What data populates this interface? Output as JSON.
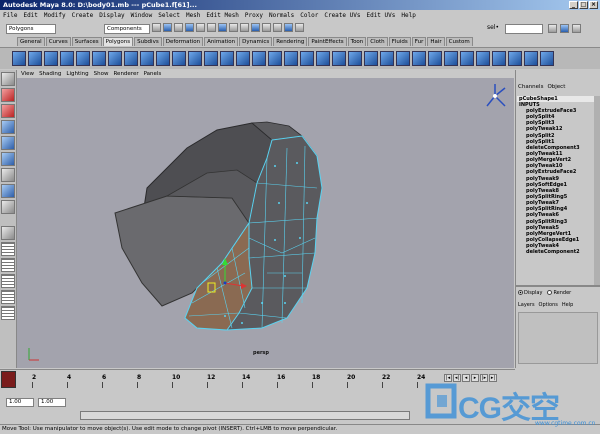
{
  "window": {
    "title": "Autodesk Maya 8.0: D:\\body01.mb   ---   pCube1.f[61]..."
  },
  "menubar": {
    "items": [
      "File",
      "Edit",
      "Modify",
      "Create",
      "Display",
      "Window",
      "Select",
      "Mesh",
      "Edit Mesh",
      "Proxy",
      "Normals",
      "Color",
      "Create UVs",
      "Edit UVs",
      "Help"
    ]
  },
  "statusline": {
    "menu_set": "Polygons",
    "select_mode": "Components",
    "sel_label": "sel•"
  },
  "shelf": {
    "tabs": [
      "General",
      "Curves",
      "Surfaces",
      "Polygons",
      "Subdivs",
      "Deformation",
      "Animation",
      "Dynamics",
      "Rendering",
      "PaintEffects",
      "Toon",
      "Cloth",
      "Fluids",
      "Fur",
      "Hair",
      "Custom"
    ],
    "active_tab": "Polygons"
  },
  "panel": {
    "menus": [
      "View",
      "Shading",
      "Lighting",
      "Show",
      "Renderer",
      "Panels"
    ],
    "camera": "persp"
  },
  "channelbox": {
    "menus": [
      "Channels",
      "Object"
    ],
    "shape": "pCubeShape1",
    "inputs_label": "INPUTS",
    "inputs": [
      "polyExtrudeFace3",
      "polySplit4",
      "polySplit3",
      "polyTweak12",
      "polySplit2",
      "polySplit1",
      "deleteComponent3",
      "polyTweak11",
      "polyMergeVert2",
      "polyTweak10",
      "polyExtrudeFace2",
      "polyTweak9",
      "polySoftEdge1",
      "polyTweak8",
      "polySplitRing5",
      "polyTweak7",
      "polySplitRing4",
      "polyTweak6",
      "polySplitRing3",
      "polyTweak5",
      "polyMergeVert1",
      "polyCollapseEdge1",
      "polyTweak4",
      "deleteComponent2"
    ],
    "display_label": "Display",
    "render_label": "Render",
    "layers_menus": [
      "Layers",
      "Options",
      "Help"
    ]
  },
  "timeline": {
    "ticks": [
      "2",
      "4",
      "6",
      "8",
      "10",
      "12",
      "14",
      "16",
      "18",
      "20",
      "22",
      "24"
    ]
  },
  "range": {
    "start": "1.00",
    "current": "1.00"
  },
  "helpline": {
    "text": "Move Tool: Use manipulator to move object(s). Use edit mode to change pivot (INSERT). Ctrl+LMB to move perpendicular."
  },
  "watermark": {
    "brand": "CG交空",
    "url": "www.cgtime.com.cn"
  },
  "colors": {
    "viewport_bg": "#a3a3ad",
    "selection_wire": "#5ad2f0",
    "title_start": "#0a246a"
  },
  "icons": [
    "maya-logo-icon",
    "select-tool-icon",
    "lasso-tool-icon",
    "paint-tool-icon",
    "move-tool-icon",
    "rotate-tool-icon",
    "scale-tool-icon",
    "view-axis-icon"
  ]
}
